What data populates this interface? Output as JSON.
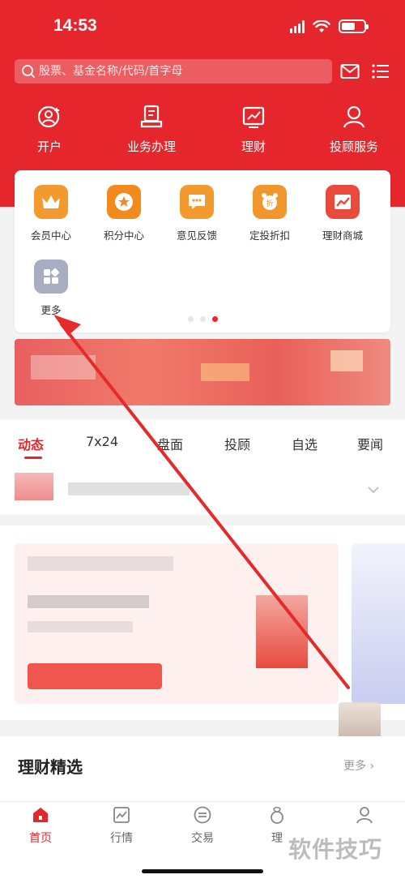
{
  "status": {
    "time": "14:53"
  },
  "search": {
    "placeholder": "股票、基金名称/代码/首字母"
  },
  "top_menu": [
    {
      "label": "开户",
      "icon": "user-add-icon"
    },
    {
      "label": "业务办理",
      "icon": "document-stamp-icon"
    },
    {
      "label": "理财",
      "icon": "chart-board-icon"
    },
    {
      "label": "投顾服务",
      "icon": "advisor-icon"
    }
  ],
  "quick_menu": [
    {
      "label": "会员中心",
      "icon": "crown-icon",
      "color": "#f29a2e"
    },
    {
      "label": "积分中心",
      "icon": "star-coin-icon",
      "color": "#f28a1e"
    },
    {
      "label": "意见反馈",
      "icon": "chat-bubble-icon",
      "color": "#f29a2e"
    },
    {
      "label": "定投折扣",
      "icon": "piggy-clock-icon",
      "color": "#f0962a"
    },
    {
      "label": "理财商城",
      "icon": "trend-chart-icon",
      "color": "#e94a3c"
    },
    {
      "label": "更多",
      "icon": "grid-more-icon",
      "color": "#a9adc2"
    }
  ],
  "tabs": [
    "动态",
    "7x24",
    "盘面",
    "投顾",
    "自选",
    "要闻"
  ],
  "finance": {
    "title": "理财精选",
    "more": "更多"
  },
  "bottom_nav": [
    {
      "label": "首页",
      "icon": "home-icon"
    },
    {
      "label": "行情",
      "icon": "market-chart-icon"
    },
    {
      "label": "交易",
      "icon": "trade-icon"
    },
    {
      "label": "理",
      "icon": "wealth-icon"
    },
    {
      "label": "",
      "icon": "profile-icon"
    }
  ],
  "watermark": "软件技巧"
}
